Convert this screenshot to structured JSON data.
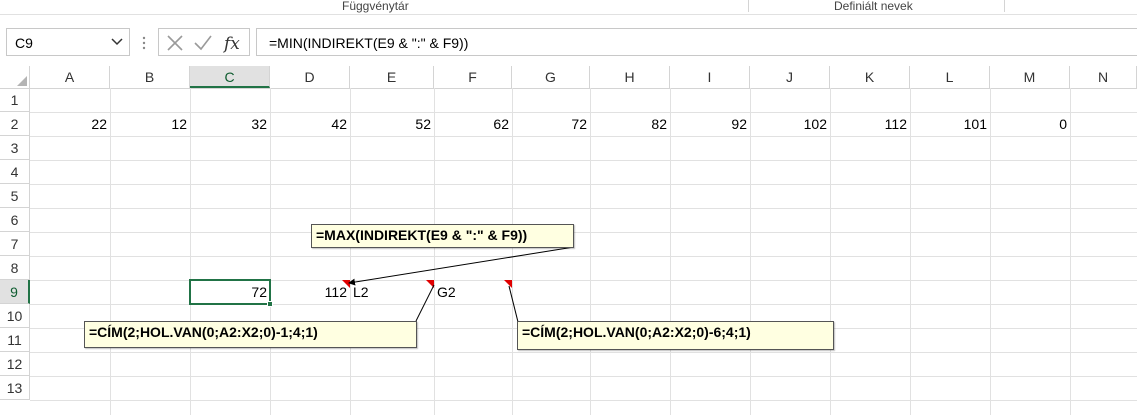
{
  "ribbon": {
    "groups": [
      "Függvénytár",
      "Definiált nevek"
    ]
  },
  "formula_bar": {
    "name_box": "C9",
    "formula": "=MIN(INDIREKT(E9 & \":\" & F9))",
    "icons": [
      "chevron-down-icon",
      "vertical-dots-icon",
      "cancel-x-icon",
      "enter-check-icon",
      "function-fx-icon"
    ]
  },
  "sheet": {
    "columns": [
      "A",
      "B",
      "C",
      "D",
      "E",
      "F",
      "G",
      "H",
      "I",
      "J",
      "K",
      "L",
      "M",
      "N"
    ],
    "rows": [
      "1",
      "2",
      "3",
      "4",
      "5",
      "6",
      "7",
      "8",
      "9",
      "10",
      "11",
      "12",
      "13"
    ],
    "selected_column": "C",
    "selected_row": "9",
    "row2_values": [
      "22",
      "12",
      "32",
      "42",
      "52",
      "62",
      "72",
      "82",
      "92",
      "102",
      "112",
      "101",
      "0"
    ],
    "row9": {
      "C9": "72",
      "D9": "112",
      "E9": "L2",
      "F9": "G2"
    }
  },
  "comments": {
    "max_formula": "=MAX(INDIREKT(E9 & \":\" & F9))",
    "cim_end_formula": "=CÍM(2;HOL.VAN(0;A2:X2;0)-1;4;1)",
    "cim_start_formula": "=CÍM(2;HOL.VAN(0;A2:X2;0)-6;4;1)"
  },
  "colors": {
    "accent": "#217346",
    "comment_bg": "#ffffe1",
    "comment_indicator": "#e00000"
  }
}
